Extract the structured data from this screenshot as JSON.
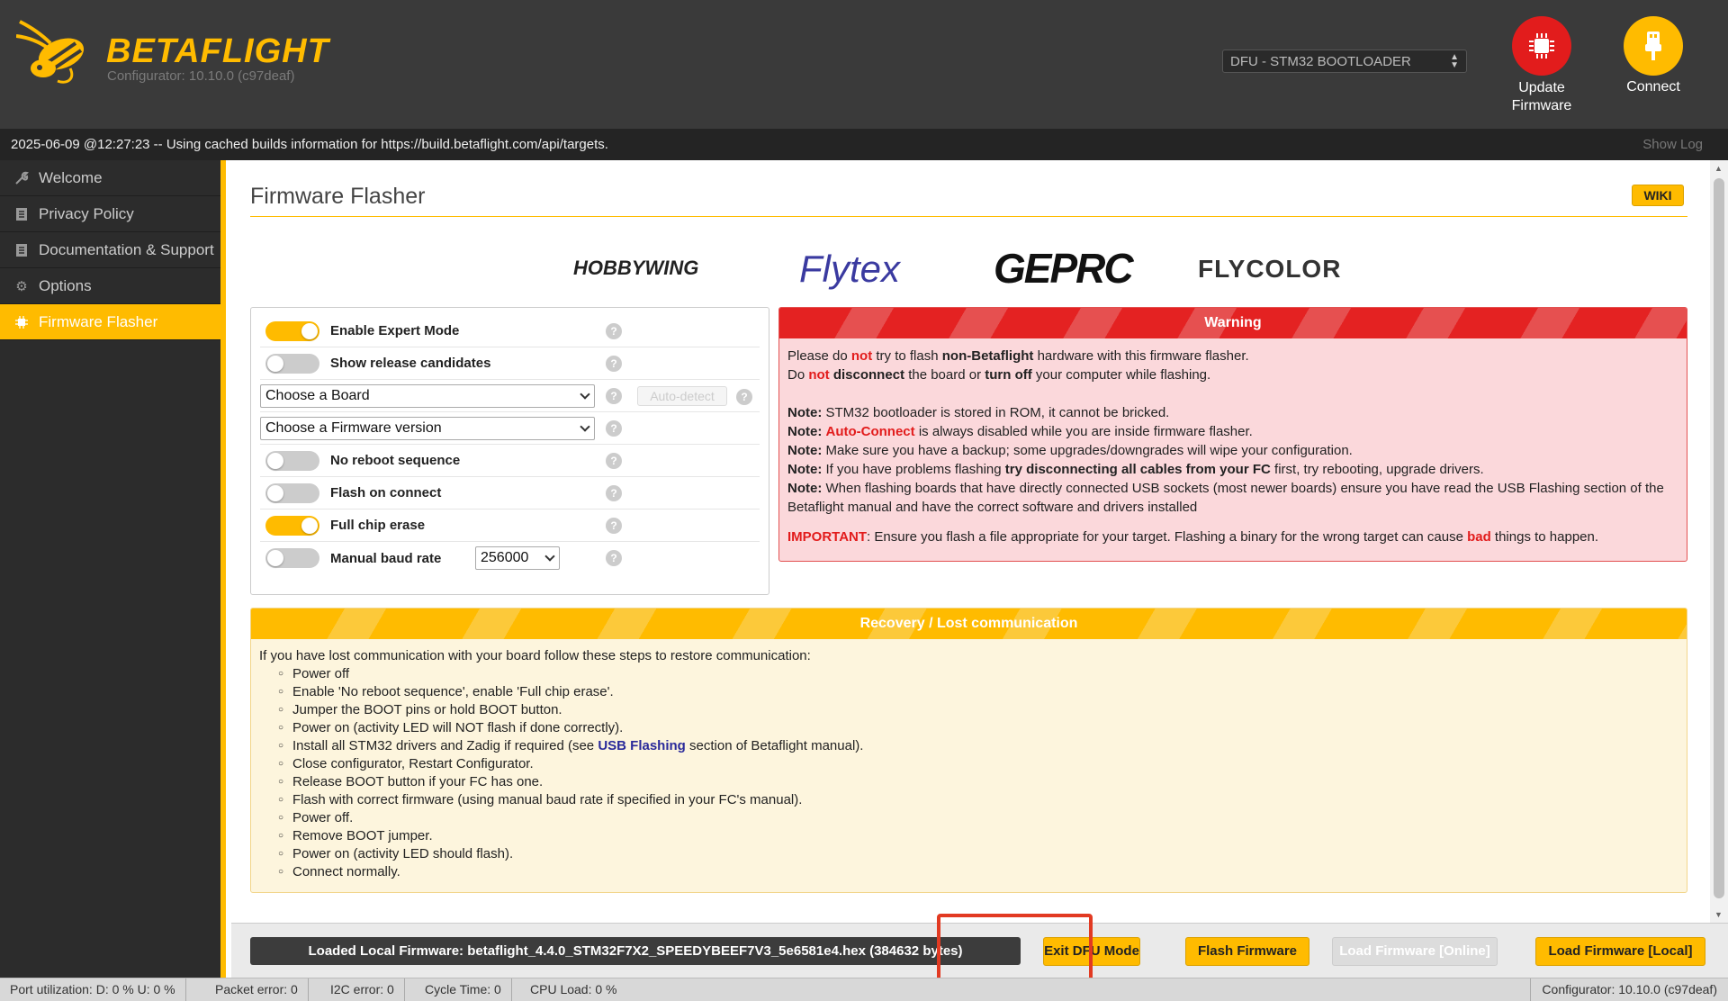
{
  "header": {
    "brand": "BETAFLIGHT",
    "version": "Configurator: 10.10.0 (c97deaf)",
    "port_selected": "DFU - STM32 BOOTLOADER",
    "update_firmware_label": "Update\nFirmware",
    "connect_label": "Connect"
  },
  "logbar": {
    "message": "2025-06-09 @12:27:23 -- Using cached builds information for https://build.betaflight.com/api/targets.",
    "show_log": "Show Log"
  },
  "sidebar": {
    "items": [
      {
        "label": "Welcome",
        "icon": "wrench-icon"
      },
      {
        "label": "Privacy Policy",
        "icon": "document-icon"
      },
      {
        "label": "Documentation & Support",
        "icon": "book-icon"
      },
      {
        "label": "Options",
        "icon": "gear-icon"
      },
      {
        "label": "Firmware Flasher",
        "icon": "chip-icon",
        "active": true
      }
    ]
  },
  "main": {
    "title": "Firmware Flasher",
    "wiki": "WIKI",
    "sponsors": [
      "HOBBYWING",
      "Flytex",
      "GEPRC",
      "FLYCOLOR"
    ],
    "options": {
      "expert_mode": {
        "label": "Enable Expert Mode",
        "on": true
      },
      "release_candidates": {
        "label": "Show release candidates",
        "on": false
      },
      "board_select": "Choose a Board",
      "auto_detect": "Auto-detect",
      "firmware_select": "Choose a Firmware version",
      "no_reboot": {
        "label": "No reboot sequence",
        "on": false
      },
      "flash_on_connect": {
        "label": "Flash on connect",
        "on": false
      },
      "full_chip_erase": {
        "label": "Full chip erase",
        "on": true
      },
      "manual_baud": {
        "label": "Manual baud rate",
        "on": false
      },
      "baud_value": "256000",
      "help": "?"
    },
    "warning": {
      "title": "Warning",
      "l1a": "Please do ",
      "l1b": "not",
      "l1c": " try to flash ",
      "l1d": "non-Betaflight",
      "l1e": " hardware with this firmware flasher.",
      "l2a": "Do ",
      "l2b": "not",
      "l2c": " ",
      "l2d": "disconnect",
      "l2e": " the board or ",
      "l2f": "turn off",
      "l2g": " your computer while flashing.",
      "note": "Note:",
      "n1": " STM32 bootloader is stored in ROM, it cannot be bricked.",
      "n2a": "Auto-Connect",
      "n2b": " is always disabled while you are inside firmware flasher.",
      "n3": " Make sure you have a backup; some upgrades/downgrades will wipe your configuration.",
      "n4a": " If you have problems flashing ",
      "n4b": "try disconnecting all cables from your FC",
      "n4c": " first, try rebooting, upgrade drivers.",
      "n5": " When flashing boards that have directly connected USB sockets (most newer boards) ensure you have read the USB Flashing section of the Betaflight manual and have the correct software and drivers installed",
      "imp": "IMPORTANT",
      "imp_a": ": Ensure you flash a file appropriate for your target. Flashing a binary for the wrong target can cause ",
      "imp_b": "bad",
      "imp_c": " things to happen."
    },
    "recovery": {
      "title": "Recovery / Lost communication",
      "intro": "If you have lost communication with your board follow these steps to restore communication:",
      "steps": [
        "Power off",
        "Enable 'No reboot sequence', enable 'Full chip erase'.",
        "Jumper the BOOT pins or hold BOOT button.",
        "Power on (activity LED will NOT flash if done correctly).",
        "Install all STM32 drivers and Zadig if required (see ",
        "Close configurator, Restart Configurator.",
        "Release BOOT button if your FC has one.",
        "Flash with correct firmware (using manual baud rate if specified in your FC's manual).",
        "Power off.",
        "Remove BOOT jumper.",
        "Power on (activity LED should flash).",
        "Connect normally."
      ],
      "usb_link": "USB Flashing",
      "usb_tail": " section of Betaflight manual)."
    }
  },
  "toolbar": {
    "loaded": "Loaded Local Firmware: betaflight_4.4.0_STM32F7X2_SPEEDYBEEF7V3_5e6581e4.hex (384632 bytes)",
    "exit_dfu": "Exit DFU Mode",
    "flash": "Flash Firmware",
    "load_online": "Load Firmware [Online]",
    "load_local": "Load Firmware [Local]"
  },
  "status": {
    "port_util": "Port utilization: D: 0 % U: 0 %",
    "packet_error": "Packet error: 0",
    "i2c_error": "I2C error: 0",
    "cycle_time": "Cycle Time: 0",
    "cpu_load": "CPU Load: 0 %",
    "configurator": "Configurator: 10.10.0 (c97deaf)"
  },
  "colors": {
    "accent": "#ffbb00",
    "danger": "#e21c1c",
    "header_bg": "#3a3a3a"
  }
}
